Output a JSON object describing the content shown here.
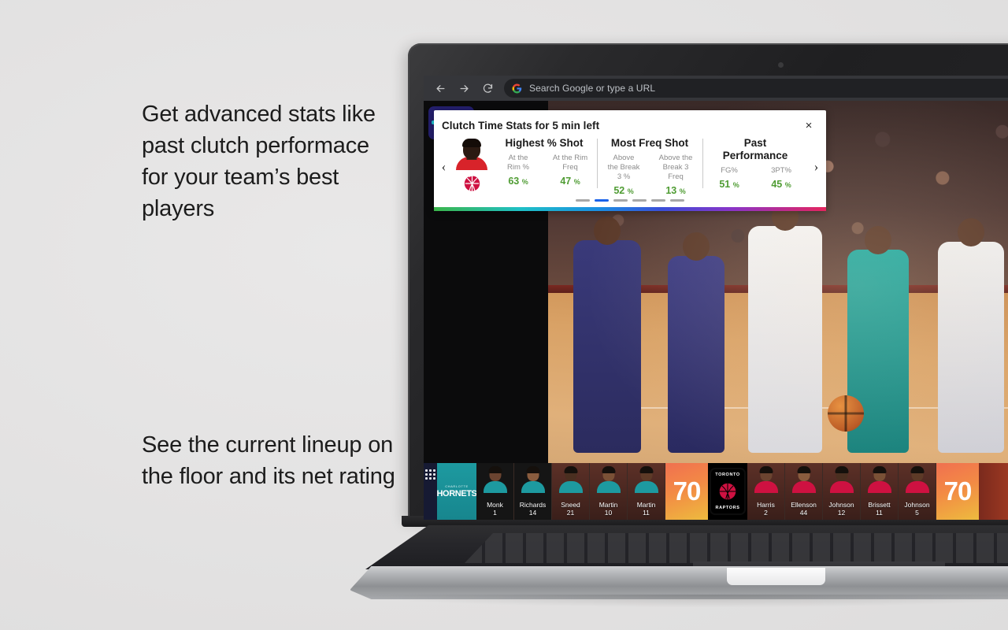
{
  "marketing": {
    "top_copy": "Get advanced stats like past clutch performace for your team’s best players",
    "bottom_copy": "See the current lineup on the floor and its net rating"
  },
  "browser": {
    "back_icon": "back-arrow-icon",
    "forward_icon": "forward-arrow-icon",
    "reload_icon": "reload-icon",
    "omnibox_placeholder": "Search Google or type a URL",
    "omnibox_value": "",
    "search_engine_icon": "google-icon"
  },
  "stats_card": {
    "title": "Clutch Time Stats for 5 min left",
    "close_label": "×",
    "prev_label": "‹",
    "next_label": "›",
    "player_team": "Toronto Raptors",
    "columns": [
      {
        "title": "Highest % Shot",
        "metrics": [
          {
            "label": "At the\nRim %",
            "value": "63",
            "unit": "%"
          },
          {
            "label": "At the Rim\nFreq",
            "value": "47",
            "unit": "%"
          }
        ]
      },
      {
        "title": "Most Freq Shot",
        "metrics": [
          {
            "label": "Above\nthe Break\n3 %",
            "value": "52",
            "unit": "%"
          },
          {
            "label": "Above the\nBreak 3\nFreq",
            "value": "13",
            "unit": "%"
          }
        ]
      },
      {
        "title": "Past\nPerformance",
        "metrics": [
          {
            "label": "FG%",
            "value": "51",
            "unit": "%"
          },
          {
            "label": "3PT%",
            "value": "45",
            "unit": "%"
          }
        ]
      }
    ],
    "pagination": {
      "count": 6,
      "active_index": 1
    },
    "accent_green": "#4f9c33",
    "accent_blue": "#1a62ea",
    "gradient_colors": [
      "#3bb54a",
      "#1fc0c6",
      "#1b8fe3",
      "#3a4fd8",
      "#8a35c8",
      "#e5255e"
    ]
  },
  "lineup": {
    "grid_icon": "grid-menu-icon",
    "away": {
      "team_name": "HORNETS",
      "team_city": "CHARLOTTE",
      "score": "70",
      "primary_color": "#1d9aa0",
      "players": [
        {
          "name": "Monk",
          "number": "1"
        },
        {
          "name": "Richards",
          "number": "14"
        },
        {
          "name": "Sneed",
          "number": "21"
        },
        {
          "name": "Martin",
          "number": "10"
        },
        {
          "name": "Martin",
          "number": "11"
        }
      ]
    },
    "home": {
      "team_name": "RAPTORS",
      "team_city": "TORONTO",
      "score": "70",
      "primary_color": "#ce1141",
      "players": [
        {
          "name": "Harris",
          "number": "2"
        },
        {
          "name": "Ellenson",
          "number": "44"
        },
        {
          "name": "Johnson",
          "number": "12"
        },
        {
          "name": "Brissett",
          "number": "11"
        },
        {
          "name": "Johnson",
          "number": "5"
        }
      ]
    }
  }
}
